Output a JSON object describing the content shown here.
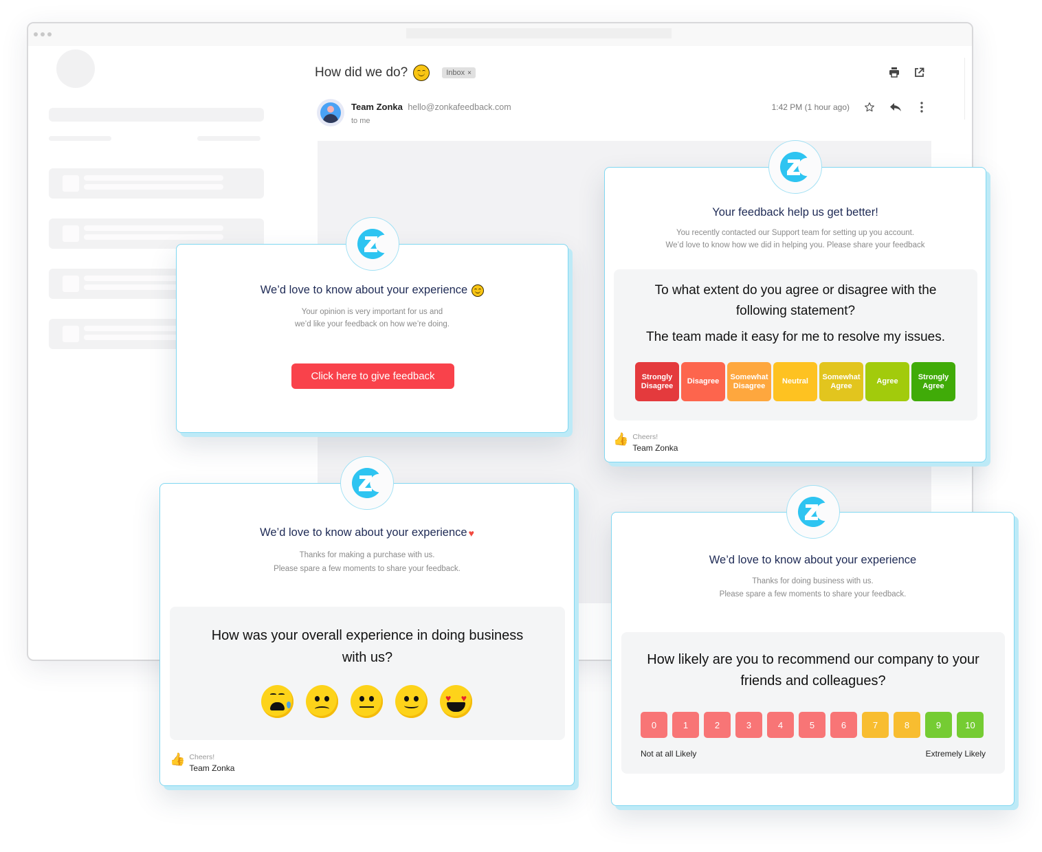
{
  "email": {
    "subject": "How did we do?",
    "label_chip": "Inbox",
    "label_chip_close": "×",
    "sender_name": "Team Zonka",
    "sender_email": "hello@zonkafeedback.com",
    "recipient": "to me",
    "time": "1:42 PM (1 hour ago)",
    "icons": [
      "print-icon",
      "open-in-new-window-icon",
      "star-icon",
      "reply-icon",
      "more-vertical-icon"
    ]
  },
  "cards": {
    "cta": {
      "title": "We’d love to know about your experience",
      "subtitle_lines": [
        "Your opinion is very important for us and",
        "we’d like your feedback on how we’re doing."
      ],
      "button": "Click here to give feedback"
    },
    "likert": {
      "title": "Your feedback help us get better!",
      "subtitle_lines": [
        "You recently contacted our Support team for setting up you account.",
        "We’d love to know how we did in helping you. Please share your feedback"
      ],
      "question": "To what extent do you agree or disagree with the following statement?",
      "statement": "The team made it easy for me to resolve my issues.",
      "options": [
        {
          "label_line1": "Strongly",
          "label_line2": "Disagree",
          "color": "#e43a3d"
        },
        {
          "label_line1": "Disagree",
          "label_line2": "",
          "color": "#fd654d"
        },
        {
          "label_line1": "Somewhat",
          "label_line2": "Disagree",
          "color": "#fea73e"
        },
        {
          "label_line1": "Neutral",
          "label_line2": "",
          "color": "#fec221"
        },
        {
          "label_line1": "Somewhat",
          "label_line2": "Agree",
          "color": "#e2c51e"
        },
        {
          "label_line1": "Agree",
          "label_line2": "",
          "color": "#a2cb0c"
        },
        {
          "label_line1": "Strongly",
          "label_line2": "Agree",
          "color": "#40ab08"
        }
      ],
      "signoff": "Cheers!",
      "team": "Team Zonka"
    },
    "emoji": {
      "title": "We’d love to know about your experience",
      "subtitle_lines": [
        "Thanks for making a purchase with us.",
        "Please spare a few moments to share your feedback."
      ],
      "question": "How was your overall experience in doing business with us?",
      "faces": [
        "crying-face",
        "sad-face",
        "neutral-face",
        "smiling-face",
        "heart-eyes-face"
      ],
      "signoff": "Cheers!",
      "team": "Team Zonka"
    },
    "nps": {
      "title": "We’d love to know about your experience",
      "subtitle_lines": [
        "Thanks for doing business with us.",
        "Please spare a few moments to share your feedback."
      ],
      "question": "How likely are you to recommend our company to your friends and colleagues?",
      "scale": [
        {
          "value": "0",
          "color": "#f87576"
        },
        {
          "value": "1",
          "color": "#f87576"
        },
        {
          "value": "2",
          "color": "#f87576"
        },
        {
          "value": "3",
          "color": "#f87576"
        },
        {
          "value": "4",
          "color": "#f87576"
        },
        {
          "value": "5",
          "color": "#f87576"
        },
        {
          "value": "6",
          "color": "#f87576"
        },
        {
          "value": "7",
          "color": "#f8bd30"
        },
        {
          "value": "8",
          "color": "#f8bd30"
        },
        {
          "value": "9",
          "color": "#75cc33"
        },
        {
          "value": "10",
          "color": "#75cc33"
        }
      ],
      "low_label": "Not at all Likely",
      "high_label": "Extremely Likely"
    }
  },
  "colors": {
    "brand_blue": "#2ec4f1",
    "cta_red": "#f9424b",
    "title_navy": "#1e2a55",
    "card_border": "#7fd7f1"
  }
}
